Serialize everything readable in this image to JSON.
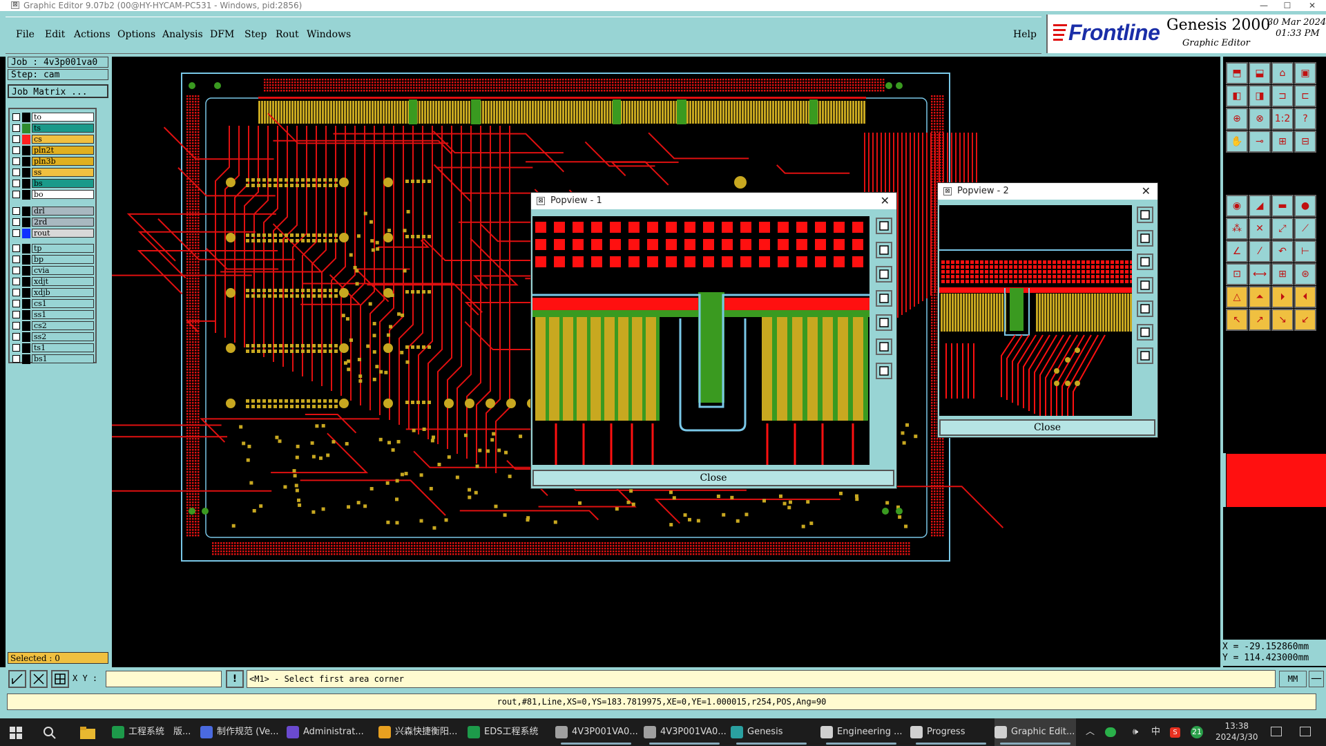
{
  "window": {
    "title": "Graphic Editor 9.07b2 (00@HY-HYCAM-PC531 - Windows, pid:2856)",
    "minimize": "—",
    "maximize": "☐",
    "close": "✕"
  },
  "menu": {
    "items": [
      "File",
      "Edit",
      "Actions",
      "Options",
      "Analysis",
      "DFM",
      "Step",
      "Rout",
      "Windows"
    ],
    "help": "Help"
  },
  "brand": {
    "logo": "Frontline",
    "product": "Genesis 2000",
    "subtitle": "Graphic Editor",
    "date": "30 Mar 2024",
    "time": "01:33 PM"
  },
  "job": {
    "job_label": "Job : 4v3p001va0",
    "step_label": "Step: cam",
    "matrix_button": "Job Matrix ..."
  },
  "layers": {
    "group1": [
      {
        "name": "to",
        "swatch": "#000000",
        "bg": "#ffffff"
      },
      {
        "name": "ts",
        "swatch": "#2e8b2e",
        "bg": "#1a9a8a"
      },
      {
        "name": "cs",
        "swatch": "#ff2020",
        "bg": "#f0c040"
      },
      {
        "name": "pln2t",
        "swatch": "#000000",
        "bg": "#e0b020"
      },
      {
        "name": "pln3b",
        "swatch": "#000000",
        "bg": "#e0b020"
      },
      {
        "name": "ss",
        "swatch": "#000000",
        "bg": "#f0c040"
      },
      {
        "name": "bs",
        "swatch": "#000000",
        "bg": "#1a9a8a"
      },
      {
        "name": "bo",
        "swatch": "#000000",
        "bg": "#ffffff"
      }
    ],
    "group2": [
      {
        "name": "drl",
        "swatch": "#000000",
        "bg": "#a8b8c0"
      },
      {
        "name": "2rd",
        "swatch": "#000000",
        "bg": "#a8b8c0"
      },
      {
        "name": "rout",
        "swatch": "#1030ff",
        "bg": "#d8d8d8"
      }
    ],
    "group3": [
      {
        "name": "tp",
        "swatch": "#000000",
        "bg": "#98d4d4"
      },
      {
        "name": "bp",
        "swatch": "#000000",
        "bg": "#98d4d4"
      },
      {
        "name": "cvia",
        "swatch": "#000000",
        "bg": "#98d4d4"
      },
      {
        "name": "xdjt",
        "swatch": "#000000",
        "bg": "#98d4d4"
      },
      {
        "name": "xdjb",
        "swatch": "#000000",
        "bg": "#98d4d4"
      },
      {
        "name": "cs1",
        "swatch": "#000000",
        "bg": "#98d4d4"
      },
      {
        "name": "ss1",
        "swatch": "#000000",
        "bg": "#98d4d4"
      },
      {
        "name": "cs2",
        "swatch": "#000000",
        "bg": "#98d4d4"
      },
      {
        "name": "ss2",
        "swatch": "#000000",
        "bg": "#98d4d4"
      },
      {
        "name": "ts1",
        "swatch": "#000000",
        "bg": "#98d4d4"
      },
      {
        "name": "bs1",
        "swatch": "#000000",
        "bg": "#98d4d4"
      }
    ]
  },
  "selected": "Selected : 0",
  "popview1": {
    "title": "Popview - 1",
    "close": "Close"
  },
  "popview2": {
    "title": "Popview - 2",
    "close": "Close"
  },
  "coords": {
    "x": "X = -29.152860mm",
    "y": "Y = 114.423000mm"
  },
  "command": {
    "xy_label": "X Y :",
    "message": "<M1> - Select first area corner",
    "units": "MM",
    "xy_value": ""
  },
  "status": "rout,#81,Line,XS=0,YS=183.7819975,XE=0,YE=1.000015,r254,POS,Ang=90",
  "taskbar": {
    "items": [
      {
        "label": "工程系统　版...",
        "color": "#1d9a4a"
      },
      {
        "label": "制作规范 (Ve...",
        "color": "#4a6adf"
      },
      {
        "label": "Administrat...",
        "color": "#6a4acf"
      },
      {
        "label": "兴森快捷衡阳...",
        "color": "#e8a020"
      },
      {
        "label": "EDS工程系统",
        "color": "#1d9a4a"
      },
      {
        "label": "4V3P001VA0...",
        "color": "#a0a0a0"
      },
      {
        "label": "4V3P001VA0...",
        "color": "#a0a0a0"
      },
      {
        "label": "Genesis",
        "color": "#2aa0a0"
      },
      {
        "label": "Engineering ...",
        "color": "#d0d0d0"
      },
      {
        "label": "Progress",
        "color": "#d0d0d0"
      },
      {
        "label": "Graphic Edit...",
        "color": "#d0d0d0"
      }
    ],
    "ime": "中",
    "notif": "21",
    "time": "13:38",
    "date": "2024/3/30"
  },
  "colors": {
    "panel": "#98d4d4",
    "trace": "#e01010",
    "pad_gold": "#c8a820",
    "outline": "#7ac8e8",
    "green": "#3a9a20"
  }
}
